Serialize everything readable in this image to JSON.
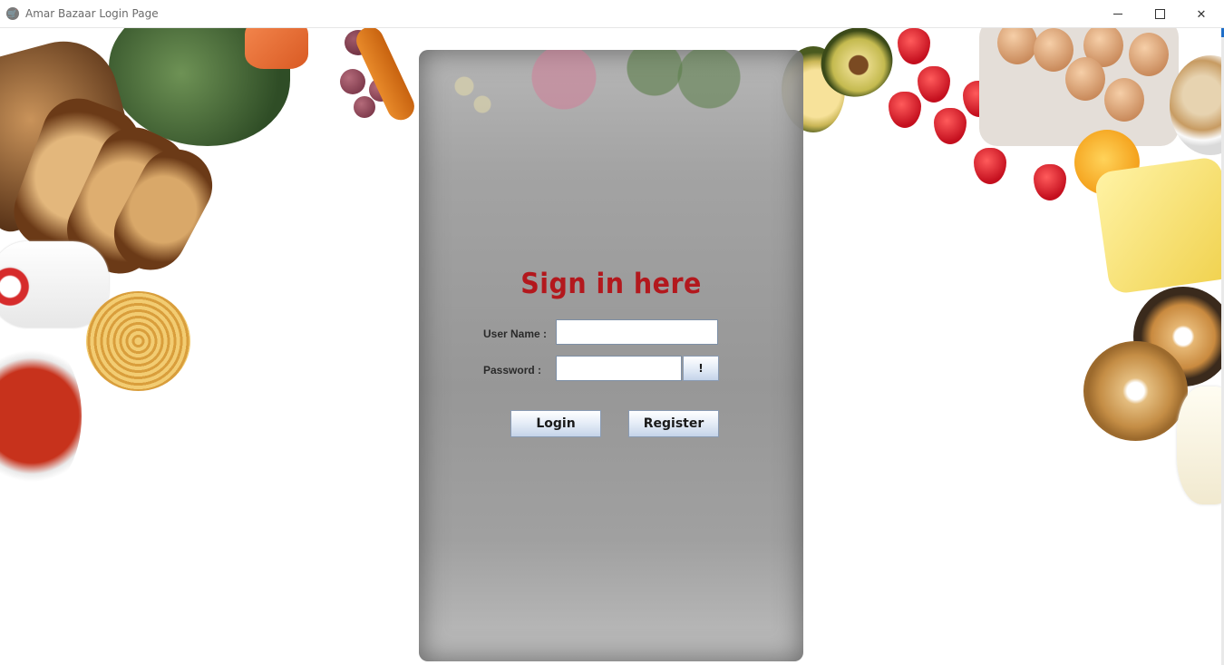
{
  "window": {
    "title": "Amar Bazaar Login Page",
    "icon": "shopping-cart-icon",
    "controls": {
      "minimize": "minimize-icon",
      "maximize": "maximize-icon",
      "close": "close-icon"
    }
  },
  "login": {
    "heading": "Sign in here",
    "username_label": "User Name :",
    "username_value": "",
    "password_label": "Password  :",
    "password_value": "",
    "show_password_label": "!",
    "login_label": "Login",
    "register_label": "Register"
  },
  "colors": {
    "heading": "#b3181d",
    "panel": "#979797",
    "button_gradient_end": "#c5d4e9"
  }
}
